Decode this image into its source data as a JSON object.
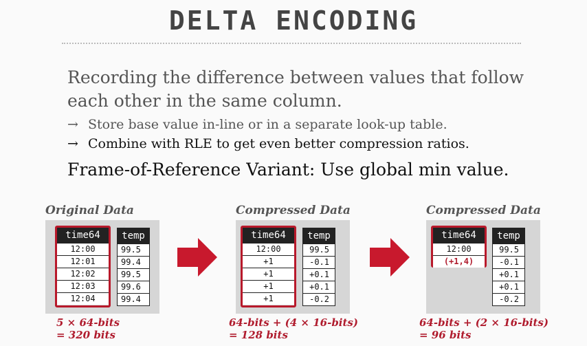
{
  "title": "DELTA ENCODING",
  "intro": [
    "Recording the difference between values that follow",
    "each other in the same column."
  ],
  "bullets": [
    {
      "arrow": "→",
      "text": "Store base value in-line or in a separate look-up table."
    },
    {
      "arrow": "→",
      "text": "Combine with RLE to get even better compression ratios."
    }
  ],
  "variant": "Frame-of-Reference Variant: Use global min value.",
  "panels": [
    {
      "label": "Original Data",
      "time_header": "time64",
      "time_values": [
        "12:00",
        "12:01",
        "12:02",
        "12:03",
        "12:04"
      ],
      "temp_header": "temp",
      "temp_values": [
        "99.5",
        "99.4",
        "99.5",
        "99.6",
        "99.4"
      ],
      "note": [
        "5 × 64-bits",
        "= 320 bits"
      ]
    },
    {
      "label": "Compressed Data",
      "time_header": "time64",
      "time_values": [
        "12:00",
        "+1",
        "+1",
        "+1",
        "+1"
      ],
      "temp_header": "temp",
      "temp_values": [
        "99.5",
        "-0.1",
        "+0.1",
        "+0.1",
        "-0.2"
      ],
      "note": [
        "64-bits + (4 × 16-bits)",
        "= 128 bits"
      ]
    },
    {
      "label": "Compressed Data",
      "time_header": "time64",
      "time_values": [
        "12:00",
        "(+1,4)"
      ],
      "temp_header": "temp",
      "temp_values": [
        "99.5",
        "-0.1",
        "+0.1",
        "+0.1",
        "-0.2"
      ],
      "note": [
        "64-bits + (2 × 16-bits)",
        "= 96 bits"
      ]
    }
  ],
  "colors": {
    "accent": "#b8192b",
    "panel": "#d6d6d6",
    "header": "#222222"
  }
}
